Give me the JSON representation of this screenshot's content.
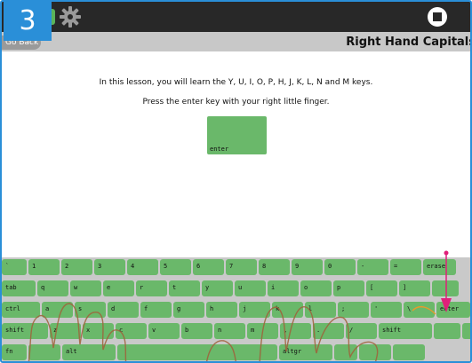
{
  "header": {
    "step_number": "3",
    "back_label": "Go Back",
    "title": "Right Hand Capitals"
  },
  "lesson": {
    "line1": "In this lesson, you will learn the Y, U, I, O, P, H, J, K, L, N and M keys.",
    "line2": "Press the enter key with your right little finger.",
    "target_key": "enter"
  },
  "keyboard": {
    "rows": [
      [
        "`",
        "1",
        "2",
        "3",
        "4",
        "5",
        "6",
        "7",
        "8",
        "9",
        "0",
        "-",
        "=",
        "erase"
      ],
      [
        "tab",
        "q",
        "w",
        "e",
        "r",
        "t",
        "y",
        "u",
        "i",
        "o",
        "p",
        "[",
        "]",
        ""
      ],
      [
        "ctrl",
        "a",
        "s",
        "d",
        "f",
        "g",
        "h",
        "j",
        "k",
        "l",
        ";",
        "'",
        "\\",
        "enter"
      ],
      [
        "shift",
        "z",
        "x",
        "c",
        "v",
        "b",
        "n",
        "m",
        ",",
        ".",
        "/",
        "shift",
        "",
        ""
      ],
      [
        "fn",
        "",
        "alt",
        "",
        "altgr",
        "",
        "",
        ""
      ]
    ]
  },
  "colors": {
    "accent": "#2a8fd8",
    "key_green": "#6ab86a",
    "hint_arrow": "#e0207a",
    "hand_outline": "#a0603a"
  }
}
